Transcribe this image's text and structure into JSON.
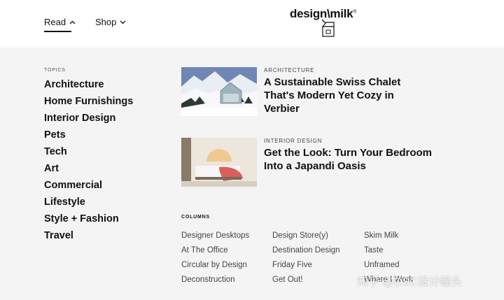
{
  "nav": {
    "read_label": "Read",
    "shop_label": "Shop"
  },
  "logo": {
    "text": "design\\milk",
    "reg": "®"
  },
  "topics": {
    "label": "TOPICS",
    "items": [
      "Architecture",
      "Home Furnishings",
      "Interior Design",
      "Pets",
      "Tech",
      "Art",
      "Commercial",
      "Lifestyle",
      "Style + Fashion",
      "Travel"
    ]
  },
  "articles": [
    {
      "category": "ARCHITECTURE",
      "title": "A Sustainable Swiss Chalet That's Modern Yet Cozy in Verbier"
    },
    {
      "category": "INTERIOR DESIGN",
      "title": "Get the Look: Turn Your Bedroom Into a Japandi Oasis"
    }
  ],
  "columns": {
    "label": "COLUMNS",
    "col1": [
      "Designer Desktops",
      "At The Office",
      "Circular by Design",
      "Deconstruction"
    ],
    "col2": [
      "Design Store(y)",
      "Destination Design",
      "Friday Five",
      "Get Out!"
    ],
    "col3": [
      "Skim Milk",
      "Taste",
      "Unframed",
      "Where I Work"
    ]
  },
  "watermark": "知乎 @DSC设计瞳头",
  "colors": {
    "background": "#f4f4f4",
    "header": "#ffffff",
    "text": "#111111"
  }
}
